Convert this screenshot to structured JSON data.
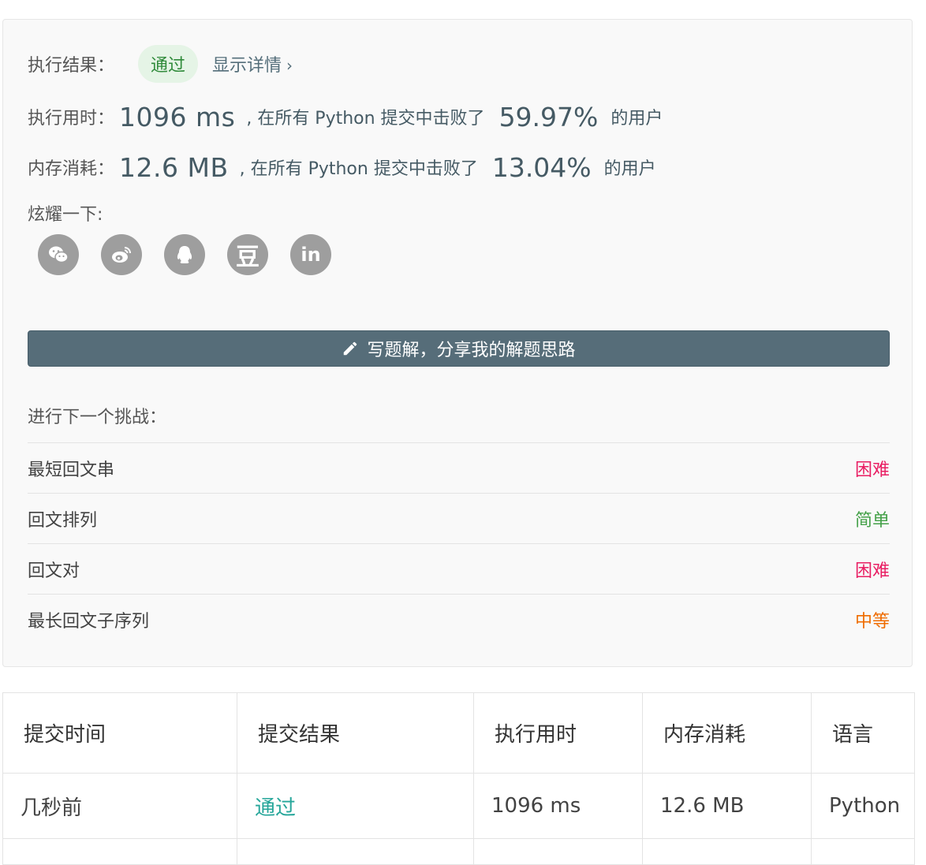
{
  "result": {
    "label": "执行结果：",
    "status": "通过",
    "details_link": "显示详情",
    "details_chevron": "›"
  },
  "runtime": {
    "label": "执行用时：",
    "value": "1096 ms",
    "mid_text": ", 在所有 Python 提交中击败了",
    "percent": "59.97%",
    "suffix": "的用户"
  },
  "memory": {
    "label": "内存消耗：",
    "value": "12.6 MB",
    "mid_text": ", 在所有 Python 提交中击败了",
    "percent": "13.04%",
    "suffix": "的用户"
  },
  "share": {
    "label": "炫耀一下:",
    "icons": [
      "wechat-icon",
      "weibo-icon",
      "qq-icon",
      "douban-icon",
      "linkedin-icon"
    ],
    "douban_glyph": "豆",
    "linkedin_glyph": "in"
  },
  "write_button": {
    "label": "写题解，分享我的解题思路",
    "icon": "pencil-icon"
  },
  "next_challenge": {
    "title": "进行下一个挑战：",
    "items": [
      {
        "name": "最短回文串",
        "difficulty": "困难"
      },
      {
        "name": "回文排列",
        "difficulty": "简单"
      },
      {
        "name": "回文对",
        "difficulty": "困难"
      },
      {
        "name": "最长回文子序列",
        "difficulty": "中等"
      }
    ]
  },
  "colors": {
    "hard": "#e91e63",
    "easy": "#43a047",
    "medium": "#ef6c00",
    "pass": "#26a69a",
    "button": "#566d79"
  },
  "submissions": {
    "headers": [
      "提交时间",
      "提交结果",
      "执行用时",
      "内存消耗",
      "语言"
    ],
    "rows": [
      [
        "几秒前",
        "通过",
        "1096 ms",
        "12.6 MB",
        "Python"
      ]
    ]
  }
}
